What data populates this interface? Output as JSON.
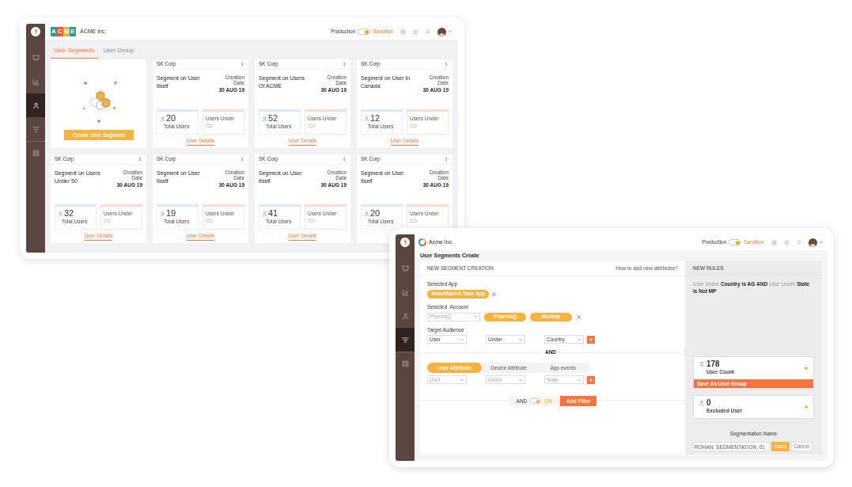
{
  "back_window": {
    "sidebar": [
      {
        "selected": false
      },
      {
        "selected": false
      },
      {
        "selected": true
      },
      {
        "selected": false
      },
      {
        "selected": false
      }
    ],
    "logo_tiles": [
      {
        "letter": "A",
        "color": "#2d9c95"
      },
      {
        "letter": "C",
        "color": "#e85d3a"
      },
      {
        "letter": "M",
        "color": "#f2b33d"
      },
      {
        "letter": "E",
        "color": "#2d9c95"
      }
    ],
    "brand": "ACME Inc.",
    "environment": {
      "left": "Production",
      "right": "Sandbox",
      "on": true
    },
    "tabs": [
      {
        "label": "User Segments",
        "selected": true
      },
      {
        "label": "User Group",
        "selected": false
      }
    ],
    "create_button": "Create User Segment",
    "segments": [
      {
        "company": "SK Corp",
        "title": "Segment on User Itself",
        "date_label": "Creation Date",
        "date": "30 AUG 19",
        "total": "20",
        "total_label": "Total Users",
        "under_label": "Users Under",
        "details": "User Details"
      },
      {
        "company": "SK Corp",
        "title": "Segment on Users Of ACME",
        "date_label": "Creation Date",
        "date": "30 AUG 19",
        "total": "52",
        "total_label": "Total Users",
        "under_label": "Users Under",
        "details": "User Details"
      },
      {
        "company": "SK Corp",
        "title": "Segment on User In Canada",
        "date_label": "Creation Date",
        "date": "30 AUG 19",
        "total": "12",
        "total_label": "Total Users",
        "under_label": "Users Under",
        "details": "User Details"
      },
      {
        "company": "SK Corp",
        "title": "Segment on Users Under 50",
        "date_label": "Creation Date",
        "date": "30 AUG 19",
        "total": "32",
        "total_label": "Total Users",
        "under_label": "Users Under",
        "details": "User Details"
      },
      {
        "company": "SK Corp",
        "title": "Segment on User Itself",
        "date_label": "Creation Date",
        "date": "30 AUG 19",
        "total": "19",
        "total_label": "Total Users",
        "under_label": "Users Under",
        "details": "User Details"
      },
      {
        "company": "SK Corp",
        "title": "Segment on User Itself",
        "date_label": "Creation Date",
        "date": "30 AUG 19",
        "total": "41",
        "total_label": "Total Users",
        "under_label": "Users Under",
        "details": "User Details"
      },
      {
        "company": "SK Corp",
        "title": "Segment on User Itself",
        "date_label": "Creation Date",
        "date": "30 AUG 19",
        "total": "20",
        "total_label": "Total Users",
        "under_label": "Users Under"
      }
    ]
  },
  "front_window": {
    "sidebar": [
      {
        "selected": false
      },
      {
        "selected": false
      },
      {
        "selected": false
      },
      {
        "selected": true
      },
      {
        "selected": false
      }
    ],
    "brand": "Acme Inc.",
    "environment": {
      "left": "Production",
      "right": "Sandbox",
      "on": true
    },
    "page_title": "User Segments Create",
    "panel_title": "NEW SEGMENT CREATION",
    "help_link": "How to add new attributes?",
    "selected_app": {
      "label": "Selected App",
      "chips": [
        "SmartKarrot Task App"
      ]
    },
    "selected_account": {
      "label": "Selected  Account",
      "dropdown": {
        "placeholder": "PharmaQ"
      },
      "chips": [
        "PharmaQ",
        "Medical"
      ]
    },
    "target_audience": {
      "label": "Target Audience",
      "dropdowns": [
        {
          "value": "User"
        },
        {
          "value": "Under"
        },
        {
          "value": "Country"
        }
      ]
    },
    "joiner": "AND",
    "attribute_tabs": [
      {
        "label": "User Attribute",
        "selected": true
      },
      {
        "label": "Device Attribute",
        "selected": false
      },
      {
        "label": "App events",
        "selected": false
      }
    ],
    "attribute_dropdowns": [
      {
        "placeholder": "User"
      },
      {
        "placeholder": "Under"
      },
      {
        "placeholder": "State"
      }
    ],
    "logic_toggle": {
      "left": "AND",
      "right": "OR",
      "on": true
    },
    "add_filter": "Add Filter",
    "rules_title": "NEW RULES",
    "rule": "User Under **Country is AG** **AND** User Under **State is Not MP**",
    "user_count": {
      "value": "178",
      "label": "User Count",
      "action": "Save As User Group"
    },
    "excluded": {
      "value": "0",
      "label": "Excluded User"
    },
    "name_label": "Segmentation Name",
    "name_value": "ROHAN_SEGMENTATION_01",
    "save": "Save",
    "cancel": "Cancel"
  }
}
